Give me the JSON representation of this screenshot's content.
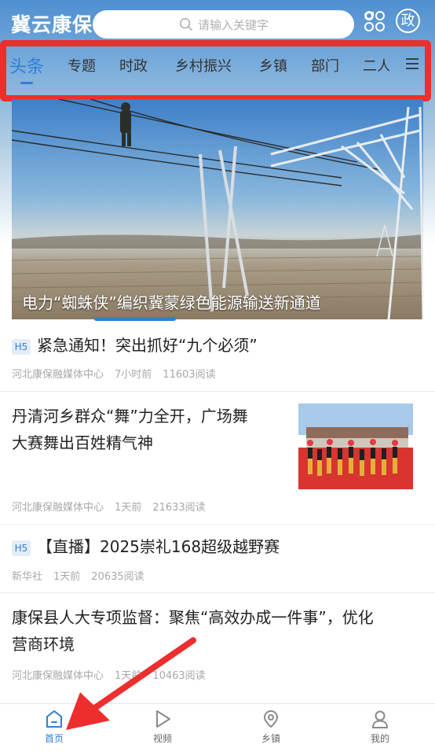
{
  "header": {
    "app_title": "冀云康保",
    "search_placeholder": "请输入关键字",
    "zheng_label": "政"
  },
  "tabs": [
    {
      "label": "头条",
      "active": true
    },
    {
      "label": "专题"
    },
    {
      "label": "时政"
    },
    {
      "label": "乡村振兴"
    },
    {
      "label": "乡镇"
    },
    {
      "label": "部门"
    },
    {
      "label": "二人"
    }
  ],
  "banner": {
    "caption": "电力“蜘蛛侠”编织冀蒙绿色能源输送新通道"
  },
  "news": [
    {
      "badge": "H5",
      "title": "紧急通知！突出抓好“九个必须”",
      "source": "河北康保融媒体中心",
      "time": "7小时前",
      "reads": "11603阅读"
    },
    {
      "title_line1": "丹清河乡群众“舞”力全开，广场舞",
      "title_line2": "大赛舞出百姓精气神",
      "source": "河北康保融媒体中心",
      "time": "1天前",
      "reads": "21633阅读"
    },
    {
      "badge": "H5",
      "title": "【直播】2025崇礼168超级越野赛",
      "source": "新华社",
      "time": "1天前",
      "reads": "20635阅读"
    },
    {
      "title_line1": "康保县人大专项监督：聚焦“高效办成一件事”，优化",
      "title_line2": "营商环境",
      "source": "河北康保融媒体中心",
      "time": "1天前",
      "reads": "10463阅读"
    }
  ],
  "bottom_nav": [
    {
      "label": "首页",
      "icon": "home-icon",
      "active": true
    },
    {
      "label": "视频",
      "icon": "play-icon"
    },
    {
      "label": "乡镇",
      "icon": "location-icon"
    },
    {
      "label": "我的",
      "icon": "user-icon"
    }
  ],
  "colors": {
    "accent": "#2f7fd8",
    "annotation_red": "#ee2d2d"
  }
}
